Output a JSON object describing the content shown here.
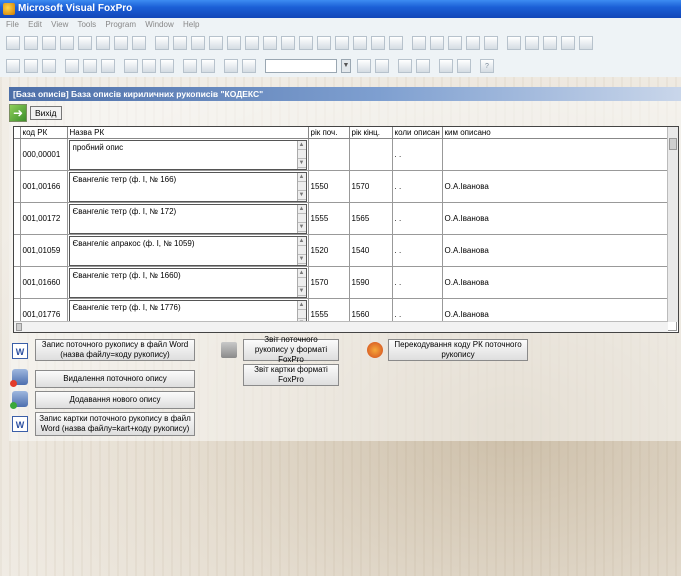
{
  "window": {
    "title": "Microsoft Visual FoxPro"
  },
  "menu": [
    "File",
    "Edit",
    "View",
    "Tools",
    "Program",
    "Window",
    "Help"
  ],
  "child": {
    "title": "[База описів] База описів кириличних рукописів \"КОДЕКС\"",
    "exit_label": "Вихід"
  },
  "grid": {
    "columns": [
      "код РК",
      "Назва РК",
      "рік поч.",
      "рік кінц.",
      "коли описан",
      "ким описано"
    ],
    "rows": [
      {
        "code": "000,00001",
        "name": "пробний опис",
        "start": "",
        "end": "",
        "when": ". .",
        "who": ""
      },
      {
        "code": "001,00166",
        "name": "Євангеліє тетр (ф. І, № 166)",
        "start": "1550",
        "end": "1570",
        "when": ". .",
        "who": "О.А.Іванова"
      },
      {
        "code": "001,00172",
        "name": "Євангеліє тетр (ф. І, № 172)",
        "start": "1555",
        "end": "1565",
        "when": ". .",
        "who": "О.А.Іванова"
      },
      {
        "code": "001,01059",
        "name": "Євангеліє апракос  (ф. І, № 1059)",
        "start": "1520",
        "end": "1540",
        "when": ". .",
        "who": "О.А.Іванова"
      },
      {
        "code": "001,01660",
        "name": "Євангеліє тетр (ф. І, № 1660)",
        "start": "1570",
        "end": "1590",
        "when": ". .",
        "who": "О.А.Іванова"
      },
      {
        "code": "001,01776",
        "name": "Євангеліє тетр (ф. І, № 1776)",
        "start": "1555",
        "end": "1560",
        "when": ". .",
        "who": "О.А.Іванова"
      }
    ]
  },
  "buttons": {
    "word_export": "Запис поточного рукопису в файл Word (назва файлу=коду рукопису)",
    "delete": "Видалення поточного опису",
    "add": "Додавання нового опису",
    "word_card": "Запис картки поточного рукопису в файл Word (назва файлу=kart+коду рукопису)",
    "report_current": "Звіт поточного рукопису у форматі FoxPro",
    "report_card": "Звіт картки форматі FoxPro",
    "recode": "Перекодування коду РК поточного рукопису"
  },
  "icons": {
    "word": "W",
    "recode": "recode-icon",
    "printer": "printer-icon",
    "database": "database-icon"
  }
}
